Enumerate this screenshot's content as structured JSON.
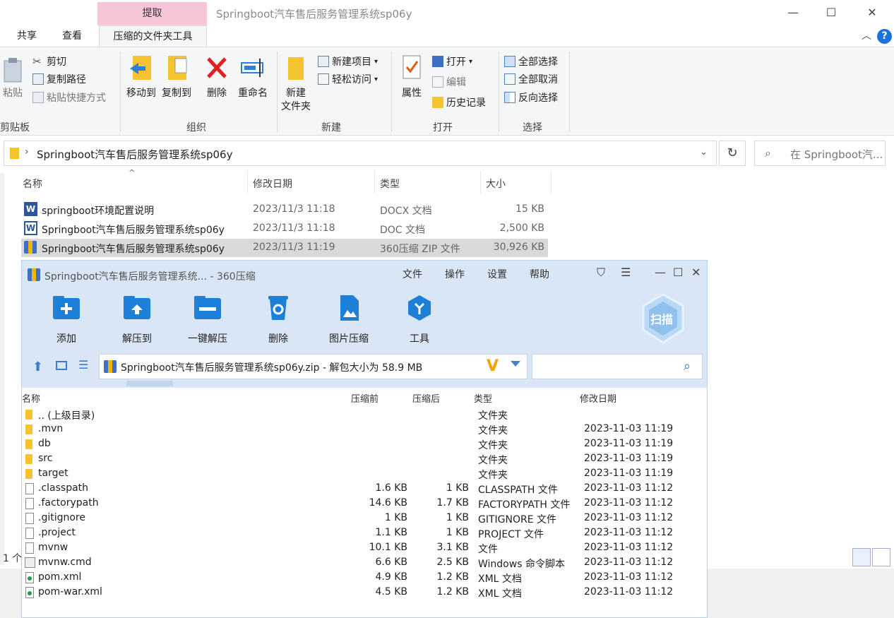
{
  "explorer": {
    "extract_tab": "提取",
    "window_title": "Springboot汽车售后服务管理系统sp06y",
    "ribbon_tabs": [
      "共享",
      "查看"
    ],
    "active_tab": "压缩的文件夹工具",
    "groups": {
      "clipboard": {
        "label": "剪贴板",
        "paste": "粘贴",
        "cut": "剪切",
        "copy_path": "复制路径",
        "paste_shortcut": "粘贴快捷方式"
      },
      "organize": {
        "label": "组织",
        "move_to": "移动到",
        "copy_to": "复制到",
        "delete": "删除",
        "rename": "重命名"
      },
      "new": {
        "label": "新建",
        "new_folder_line1": "新建",
        "new_folder_line2": "文件夹",
        "new_item": "新建项目",
        "easy_access": "轻松访问"
      },
      "open": {
        "label": "打开",
        "properties": "属性",
        "open": "打开",
        "edit": "编辑",
        "history": "历史记录"
      },
      "select": {
        "label": "选择",
        "select_all": "全部选择",
        "select_none": "全部取消",
        "invert": "反向选择"
      }
    },
    "address": "Springboot汽车售后服务管理系统sp06y",
    "search_placeholder": "在 Springboot汽...",
    "columns": {
      "name": "名称",
      "modified": "修改日期",
      "type": "类型",
      "size": "大小"
    },
    "files": [
      {
        "name": "springboot环境配置说明",
        "modified": "2023/11/3 11:18",
        "type": "DOCX 文档",
        "size": "15 KB"
      },
      {
        "name": "Springboot汽车售后服务管理系统sp06y",
        "modified": "2023/11/3 11:18",
        "type": "DOC 文档",
        "size": "2,500 KB"
      },
      {
        "name": "Springboot汽车售后服务管理系统sp06y",
        "modified": "2023/11/3 11:19",
        "type": "360压缩 ZIP 文件",
        "size": "30,926 KB"
      }
    ],
    "status_count": "1 个"
  },
  "zip": {
    "title": "Springboot汽车售后服务管理系统... - 360压缩",
    "menu": [
      "文件",
      "操作",
      "设置",
      "帮助"
    ],
    "tools": [
      "添加",
      "解压到",
      "一键解压",
      "删除",
      "图片压缩",
      "工具"
    ],
    "scan_label": "扫描",
    "path_text": "Springboot汽车售后服务管理系统sp06y.zip - 解包大小为 58.9 MB",
    "columns": {
      "name": "名称",
      "before": "压缩前",
      "after": "压缩后",
      "type": "类型",
      "modified": "修改日期"
    },
    "rows": [
      {
        "kind": "folder",
        "name": ".. (上级目录)",
        "before": "",
        "after": "",
        "type": "文件夹",
        "modified": ""
      },
      {
        "kind": "folder",
        "name": ".mvn",
        "before": "",
        "after": "",
        "type": "文件夹",
        "modified": "2023-11-03 11:19"
      },
      {
        "kind": "folder",
        "name": "db",
        "before": "",
        "after": "",
        "type": "文件夹",
        "modified": "2023-11-03 11:19"
      },
      {
        "kind": "folder",
        "name": "src",
        "before": "",
        "after": "",
        "type": "文件夹",
        "modified": "2023-11-03 11:19"
      },
      {
        "kind": "folder",
        "name": "target",
        "before": "",
        "after": "",
        "type": "文件夹",
        "modified": "2023-11-03 11:19"
      },
      {
        "kind": "file",
        "name": ".classpath",
        "before": "1.6 KB",
        "after": "1 KB",
        "type": "CLASSPATH 文件",
        "modified": "2023-11-03 11:12"
      },
      {
        "kind": "file",
        "name": ".factorypath",
        "before": "14.6 KB",
        "after": "1.7 KB",
        "type": "FACTORYPATH 文件",
        "modified": "2023-11-03 11:12"
      },
      {
        "kind": "file",
        "name": ".gitignore",
        "before": "1 KB",
        "after": "1 KB",
        "type": "GITIGNORE 文件",
        "modified": "2023-11-03 11:12"
      },
      {
        "kind": "file",
        "name": ".project",
        "before": "1.1 KB",
        "after": "1 KB",
        "type": "PROJECT 文件",
        "modified": "2023-11-03 11:12"
      },
      {
        "kind": "file",
        "name": "mvnw",
        "before": "10.1 KB",
        "after": "3.1 KB",
        "type": "文件",
        "modified": "2023-11-03 11:12"
      },
      {
        "kind": "cmd",
        "name": "mvnw.cmd",
        "before": "6.6 KB",
        "after": "2.5 KB",
        "type": "Windows 命令脚本",
        "modified": "2023-11-03 11:12"
      },
      {
        "kind": "xml",
        "name": "pom.xml",
        "before": "4.9 KB",
        "after": "1.2 KB",
        "type": "XML 文档",
        "modified": "2023-11-03 11:12"
      },
      {
        "kind": "xml",
        "name": "pom-war.xml",
        "before": "4.5 KB",
        "after": "1.2 KB",
        "type": "XML 文档",
        "modified": "2023-11-03 11:12"
      }
    ]
  },
  "colors": {
    "extract_tab": "#f7c5d8",
    "zip_toolbar": "#d8e6f6",
    "selection": "#d9d9d9",
    "accent": "#1a73d9"
  }
}
